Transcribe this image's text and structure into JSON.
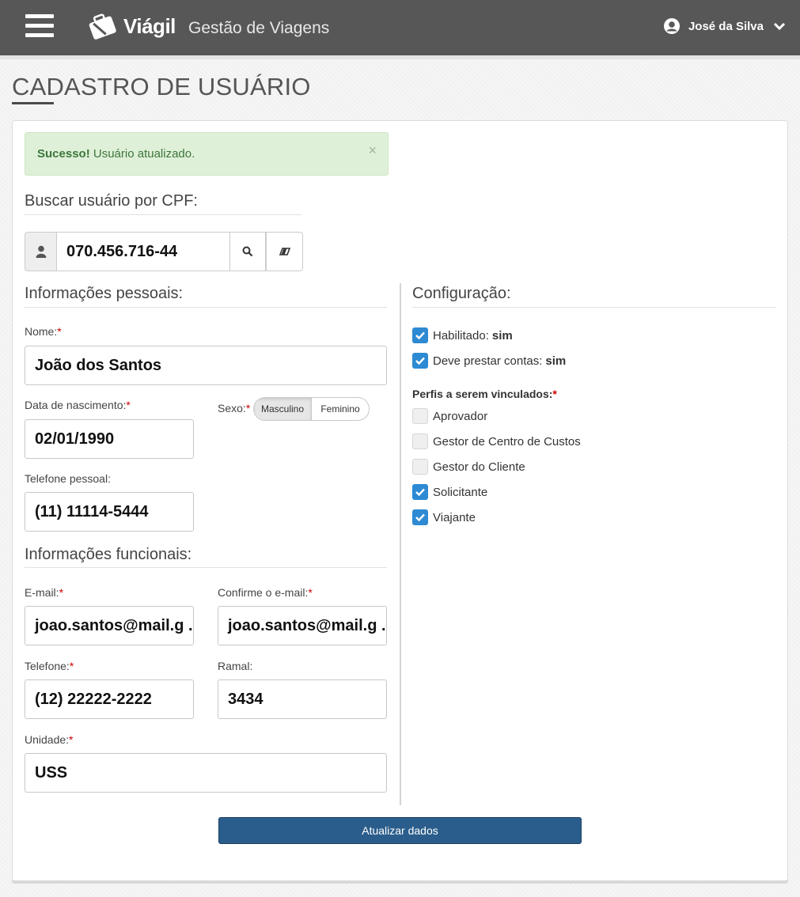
{
  "header": {
    "brand": "Viágil",
    "subtitle": "Gestão de Viagens",
    "user_name": "José da Silva"
  },
  "page": {
    "title": "CADASTRO DE USUÁRIO"
  },
  "alert": {
    "strong": "Sucesso!",
    "message": "Usuário atualizado.",
    "close": "×"
  },
  "search": {
    "title": "Buscar usuário por CPF:",
    "cpf": "070.456.716-44"
  },
  "personal": {
    "title": "Informações pessoais:",
    "name_label": "Nome:",
    "name": "João dos Santos",
    "birth_label": "Data de nascimento:",
    "birth": "02/01/1990",
    "sex_label": "Sexo:",
    "sex_options": [
      "Masculino",
      "Feminino"
    ],
    "sex_selected": "Masculino",
    "phone_label": "Telefone pessoal:",
    "phone": "(11) 11114-5444"
  },
  "work": {
    "title": "Informações funcionais:",
    "email_label": "E-mail:",
    "email": "joao.santos@mail.g ...",
    "confirm_email_label": "Confirme o e-mail:",
    "confirm_email": "joao.santos@mail.g ...",
    "phone_label": "Telefone:",
    "phone": "(12) 22222-2222",
    "extension_label": "Ramal:",
    "extension": "3434",
    "unit_label": "Unidade:",
    "unit": "USS"
  },
  "config": {
    "title": "Configuração:",
    "enabled_label": "Habilitado:",
    "enabled_value": "sim",
    "accountable_label": "Deve prestar contas:",
    "accountable_value": "sim",
    "profiles_title": "Perfis a serem vinculados:",
    "profiles": [
      {
        "label": "Aprovador",
        "checked": false
      },
      {
        "label": "Gestor de Centro de Custos",
        "checked": false
      },
      {
        "label": "Gestor do Cliente",
        "checked": false
      },
      {
        "label": "Solicitante",
        "checked": true
      },
      {
        "label": "Viajante",
        "checked": true
      }
    ]
  },
  "actions": {
    "submit": "Atualizar dados"
  },
  "colors": {
    "topbar": "#575757",
    "primary": "#2a5d8b",
    "checkbox": "#2d8ad3",
    "success_bg": "#dff0d8"
  }
}
